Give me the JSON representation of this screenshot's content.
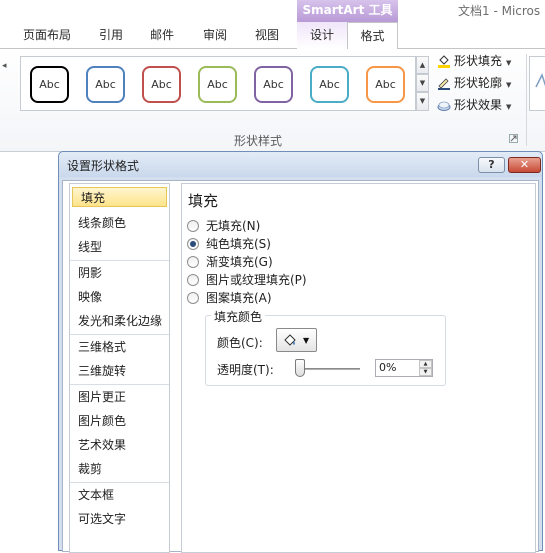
{
  "titlebar": {
    "doc_title": "文档1 - Micros",
    "context_tool": "SmartArt 工具"
  },
  "tabs": [
    {
      "label": "页面布局"
    },
    {
      "label": "引用"
    },
    {
      "label": "邮件"
    },
    {
      "label": "审阅"
    },
    {
      "label": "视图"
    },
    {
      "label": "设计"
    },
    {
      "label": "格式"
    }
  ],
  "ribbon": {
    "shape_styles": [
      {
        "label": "Abc",
        "color": "#000000"
      },
      {
        "label": "Abc",
        "color": "#4f81bd"
      },
      {
        "label": "Abc",
        "color": "#c0504d"
      },
      {
        "label": "Abc",
        "color": "#9bbb59"
      },
      {
        "label": "Abc",
        "color": "#8064a2"
      },
      {
        "label": "Abc",
        "color": "#4bacc6"
      },
      {
        "label": "Abc",
        "color": "#f79646"
      }
    ],
    "commands": {
      "shape_fill": "形状填充",
      "shape_outline": "形状轮廓",
      "shape_effects": "形状效果"
    },
    "group_label": "形状样式"
  },
  "dialog": {
    "title": "设置形状格式",
    "help_label": "?",
    "close_label": "✕",
    "nav": [
      {
        "label": "填充"
      },
      {
        "label": "线条颜色"
      },
      {
        "label": "线型"
      },
      {
        "label": "阴影"
      },
      {
        "label": "映像"
      },
      {
        "label": "发光和柔化边缘"
      },
      {
        "label": "三维格式"
      },
      {
        "label": "三维旋转"
      },
      {
        "label": "图片更正"
      },
      {
        "label": "图片颜色"
      },
      {
        "label": "艺术效果"
      },
      {
        "label": "裁剪"
      },
      {
        "label": "文本框"
      },
      {
        "label": "可选文字"
      }
    ],
    "selected_nav": "填充",
    "panel": {
      "heading": "填充",
      "options": [
        {
          "label": "无填充(N)",
          "checked": false
        },
        {
          "label": "纯色填充(S)",
          "checked": true
        },
        {
          "label": "渐变填充(G)",
          "checked": false
        },
        {
          "label": "图片或纹理填充(P)",
          "checked": false
        },
        {
          "label": "图案填充(A)",
          "checked": false
        }
      ],
      "fill_color": {
        "legend": "填充颜色",
        "color_label": "颜色(C):",
        "transparency_label": "透明度(T):",
        "transparency_value": "0%",
        "transparency_level": 0
      }
    }
  },
  "colors": {
    "context_purple": "#b899d6",
    "nav_highlight": "#fde48a",
    "dialog_frame": "#d3dfee",
    "close_red": "#c74a36"
  }
}
